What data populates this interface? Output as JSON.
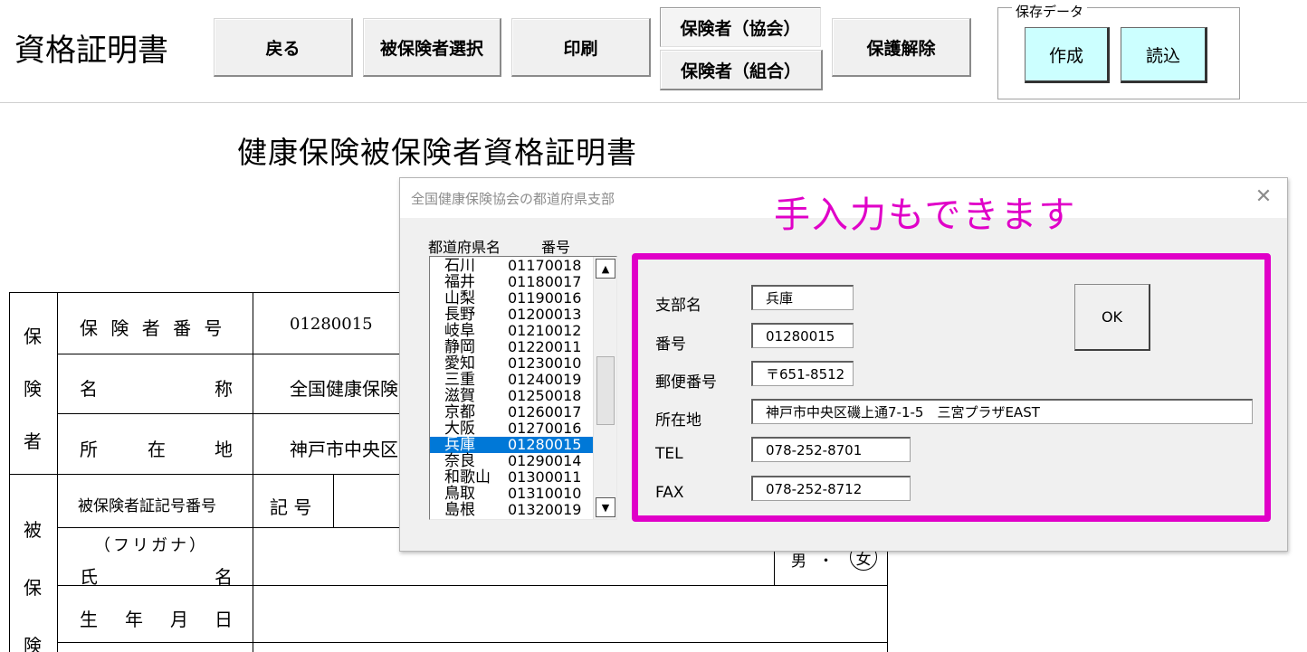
{
  "app": {
    "title": "資格証明書"
  },
  "toolbar": {
    "back": "戻る",
    "select_insured": "被保険者選択",
    "print": "印刷",
    "insurer_kyokai": "保険者（協会）",
    "insurer_kumiai": "保険者（組合）",
    "unprotect": "保護解除",
    "saved_data_group": "保存データ",
    "create": "作成",
    "load": "読込"
  },
  "document": {
    "title": "健康保険被保険者資格証明書",
    "insurer_section": [
      "保",
      "険",
      "者"
    ],
    "insured_section": [
      "被",
      "保",
      "険"
    ],
    "insurer_number_label": "保 険 者 番 号",
    "insurer_number_value": "01280015",
    "name_label_1": "名",
    "name_label_2": "称",
    "name_value": "全国健康保険",
    "address_label_1": "所",
    "address_label_2": "在",
    "address_label_3": "地",
    "address_value": "神戸市中央区",
    "card_number_label": "被保険者証記号番号",
    "symbol_label": "記 号",
    "furigana_label": "（フリガナ）",
    "person_name_label_1": "氏",
    "person_name_label_2": "名",
    "gender_male": "男",
    "gender_dot": "・",
    "gender_female": "女",
    "birth_label": [
      "生",
      "年",
      "月",
      "日"
    ]
  },
  "dialog": {
    "title": "全国健康保険協会の都道府県支部",
    "annotation": "手入力もできます",
    "list_header_name": "都道府県名",
    "list_header_number": "番号",
    "list": [
      {
        "name": "石川",
        "number": "01170018"
      },
      {
        "name": "福井",
        "number": "01180017"
      },
      {
        "name": "山梨",
        "number": "01190016"
      },
      {
        "name": "長野",
        "number": "01200013"
      },
      {
        "name": "岐阜",
        "number": "01210012"
      },
      {
        "name": "静岡",
        "number": "01220011"
      },
      {
        "name": "愛知",
        "number": "01230010"
      },
      {
        "name": "三重",
        "number": "01240019"
      },
      {
        "name": "滋賀",
        "number": "01250018"
      },
      {
        "name": "京都",
        "number": "01260017"
      },
      {
        "name": "大阪",
        "number": "01270016"
      },
      {
        "name": "兵庫",
        "number": "01280015"
      },
      {
        "name": "奈良",
        "number": "01290014"
      },
      {
        "name": "和歌山",
        "number": "01300011"
      },
      {
        "name": "鳥取",
        "number": "01310010"
      },
      {
        "name": "島根",
        "number": "01320019"
      }
    ],
    "selected_index": 11,
    "fields": {
      "branch_label": "支部名",
      "branch_value": "兵庫",
      "number_label": "番号",
      "number_value": "01280015",
      "postal_label": "郵便番号",
      "postal_value": "〒651-8512",
      "address_label": "所在地",
      "address_value": "神戸市中央区磯上通7-1-5　三宮プラザEAST",
      "tel_label": "TEL",
      "tel_value": "078-252-8701",
      "fax_label": "FAX",
      "fax_value": "078-252-8712"
    },
    "ok": "OK"
  },
  "colors": {
    "annotation": "#e000c8",
    "selection": "#0078d7",
    "saved_data_buttons": "#ccffff"
  },
  "icons": {
    "close": "close-icon",
    "scroll_up": "scroll-up-arrow-icon",
    "scroll_down": "scroll-down-arrow-icon"
  }
}
